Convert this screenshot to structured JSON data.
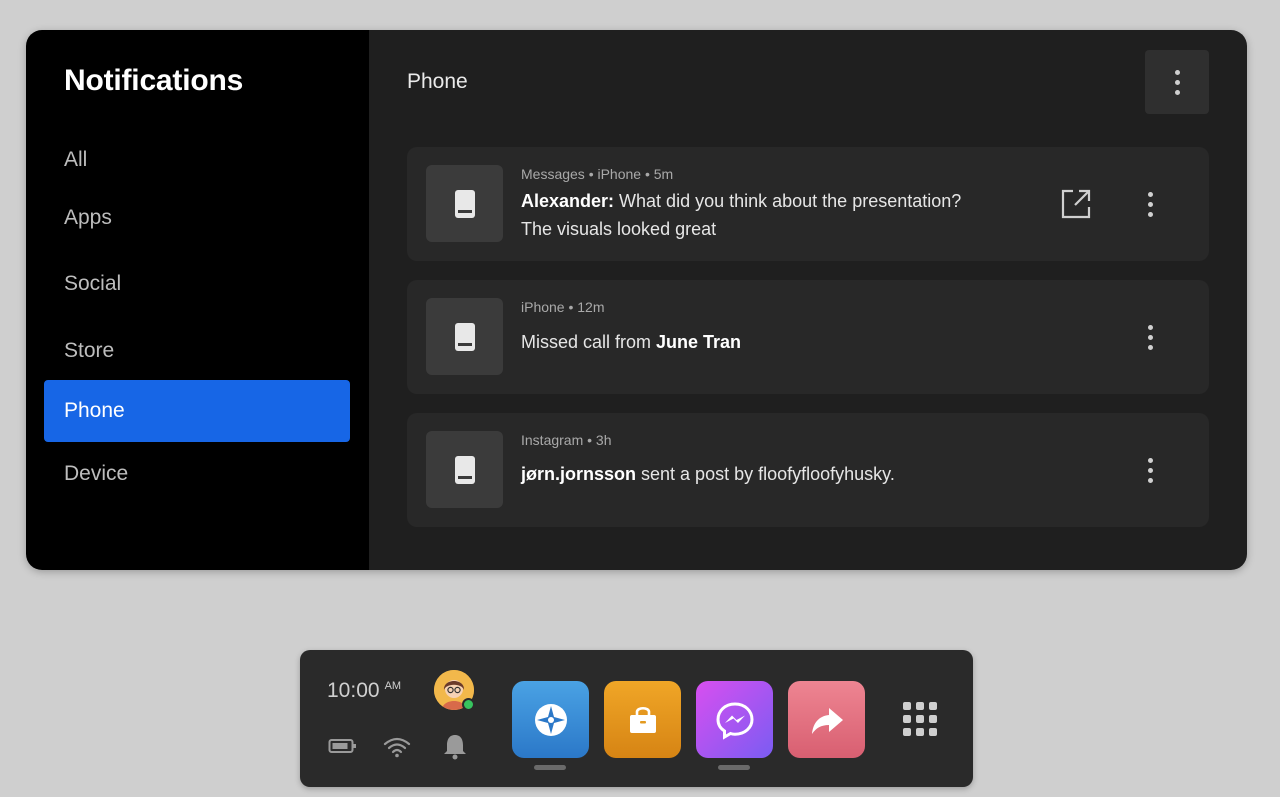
{
  "sidebar": {
    "title": "Notifications",
    "items": [
      {
        "label": "All",
        "active": false
      },
      {
        "label": "Apps",
        "active": false
      },
      {
        "label": "Social",
        "active": false
      },
      {
        "label": "Store",
        "active": false
      },
      {
        "label": "Phone",
        "active": true
      },
      {
        "label": "Device",
        "active": false
      }
    ]
  },
  "main": {
    "title": "Phone",
    "more_icon": "vertical-dots-icon",
    "notifications": [
      {
        "meta": "Messages • iPhone • 5m",
        "sender": "Alexander:",
        "message": " What did you think about the presentation?",
        "message_line2": "The visuals looked great",
        "icon": "phone-icon",
        "has_open_action": true
      },
      {
        "meta": "iPhone • 12m",
        "text_prefix": "Missed call from ",
        "name": "June Tran",
        "icon": "phone-icon"
      },
      {
        "meta": "Instagram • 3h",
        "name": "jørn.jornsson",
        "text_suffix": " sent a post by floofyfloofyhusky.",
        "icon": "phone-icon"
      }
    ]
  },
  "taskbar": {
    "time": "10:00",
    "ampm": "AM",
    "status_icons": [
      "battery-icon",
      "wifi-icon",
      "bell-icon"
    ],
    "apps": [
      {
        "name": "explore-app",
        "color": "#3a8fd8"
      },
      {
        "name": "store-app",
        "color": "#e39a1f"
      },
      {
        "name": "messenger-app",
        "color": "#a356e8"
      },
      {
        "name": "share-app",
        "color": "#e06a7e"
      }
    ],
    "apps_grid_icon": "app-grid-icon"
  }
}
